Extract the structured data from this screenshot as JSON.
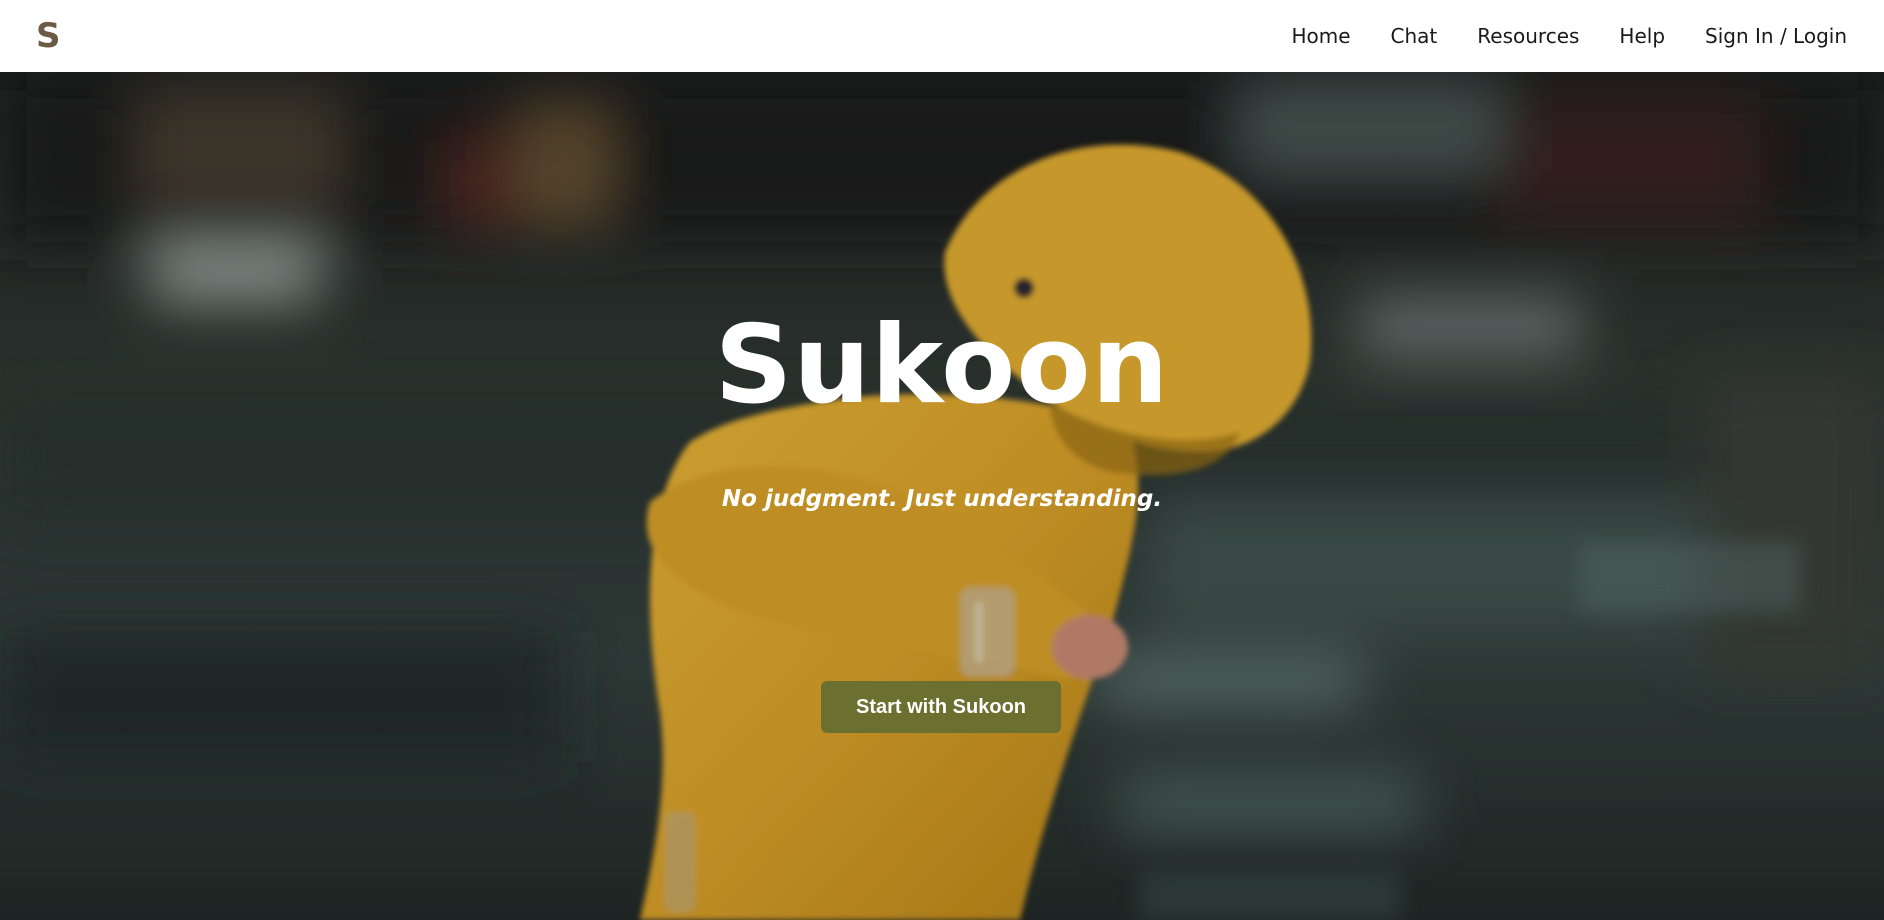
{
  "navbar": {
    "logo_text": "S",
    "links": [
      "Home",
      "Chat",
      "Resources",
      "Help",
      "Sign In / Login"
    ]
  },
  "hero": {
    "title": "Sukoon",
    "tagline": "No judgment. Just understanding.",
    "cta_label": "Start with Sukoon",
    "background_image": "child-in-yellow-raincoat-in-rain"
  },
  "colors": {
    "logo": "#6b5a44",
    "cta_background": "#6b7030",
    "raincoat": "#e0a82a",
    "navbar_background": "#ffffff"
  }
}
